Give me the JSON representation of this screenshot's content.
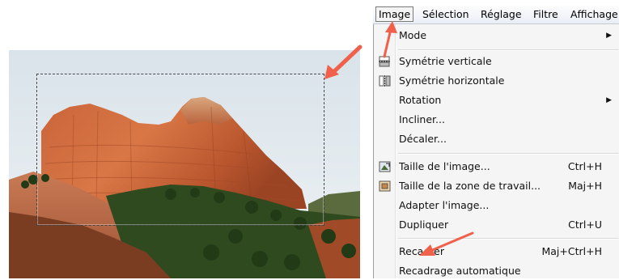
{
  "menubar": {
    "items": [
      {
        "label": "Image",
        "active": true
      },
      {
        "label": "Sélection"
      },
      {
        "label": "Réglage"
      },
      {
        "label": "Filtre"
      },
      {
        "label": "Affichage"
      }
    ]
  },
  "menu": {
    "items": [
      {
        "label": "Mode",
        "submenu": true
      },
      {
        "label": "Symétrie verticale",
        "icon": "flip-vertical-icon"
      },
      {
        "label": "Symétrie horizontale",
        "icon": "flip-horizontal-icon"
      },
      {
        "label": "Rotation",
        "submenu": true
      },
      {
        "label": "Incliner..."
      },
      {
        "label": "Décaler..."
      },
      {
        "label": "Taille de l'image...",
        "shortcut": "Ctrl+H",
        "icon": "image-size-icon"
      },
      {
        "label": "Taille de la zone de travail...",
        "shortcut": "Maj+H",
        "icon": "canvas-size-icon"
      },
      {
        "label": "Adapter l'image..."
      },
      {
        "label": "Dupliquer",
        "shortcut": "Ctrl+U"
      },
      {
        "label": "Recadrer",
        "shortcut": "Maj+Ctrl+H"
      },
      {
        "label": "Recadrage automatique"
      }
    ],
    "submenu_glyph": "▶"
  },
  "annotations": {
    "arrow_color": "#f0604a"
  }
}
